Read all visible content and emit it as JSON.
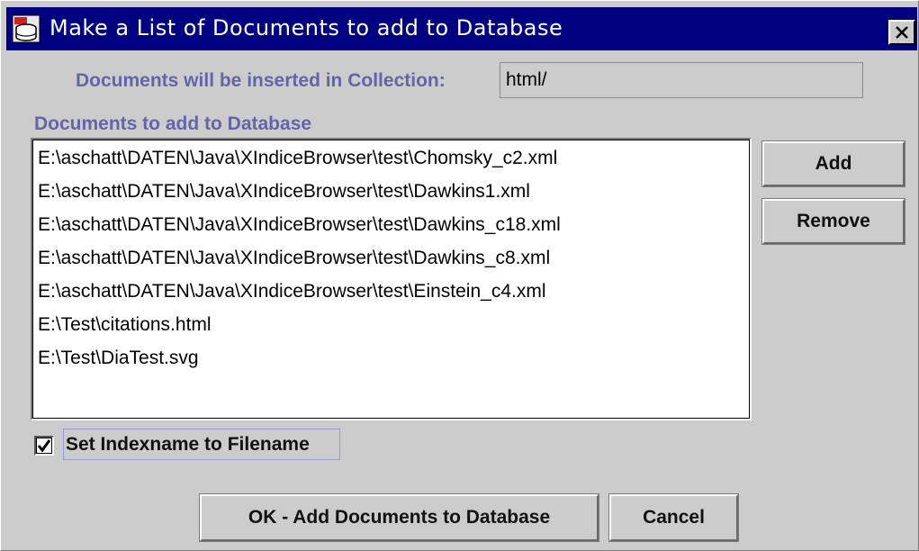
{
  "window": {
    "title": "Make a List of Documents to add to Database",
    "icon": "database-app-icon",
    "close_glyph": "close-icon"
  },
  "collection": {
    "label": "Documents will be inserted in Collection:",
    "value": "html/"
  },
  "documents": {
    "label": "Documents to add to Database",
    "items": [
      "E:\\aschatt\\DATEN\\Java\\XIndiceBrowser\\test\\Chomsky_c2.xml",
      "E:\\aschatt\\DATEN\\Java\\XIndiceBrowser\\test\\Dawkins1.xml",
      "E:\\aschatt\\DATEN\\Java\\XIndiceBrowser\\test\\Dawkins_c18.xml",
      "E:\\aschatt\\DATEN\\Java\\XIndiceBrowser\\test\\Dawkins_c8.xml",
      "E:\\aschatt\\DATEN\\Java\\XIndiceBrowser\\test\\Einstein_c4.xml",
      "E:\\Test\\citations.html",
      "E:\\Test\\DiaTest.svg"
    ]
  },
  "buttons": {
    "add": "Add",
    "remove": "Remove",
    "ok": "OK - Add Documents to Database",
    "cancel": "Cancel"
  },
  "options": {
    "index_label": "Set Indexname to Filename",
    "index_checked": true
  },
  "colors": {
    "titlebar": "#000080",
    "label": "#6464aa",
    "window": "#cccccc"
  }
}
